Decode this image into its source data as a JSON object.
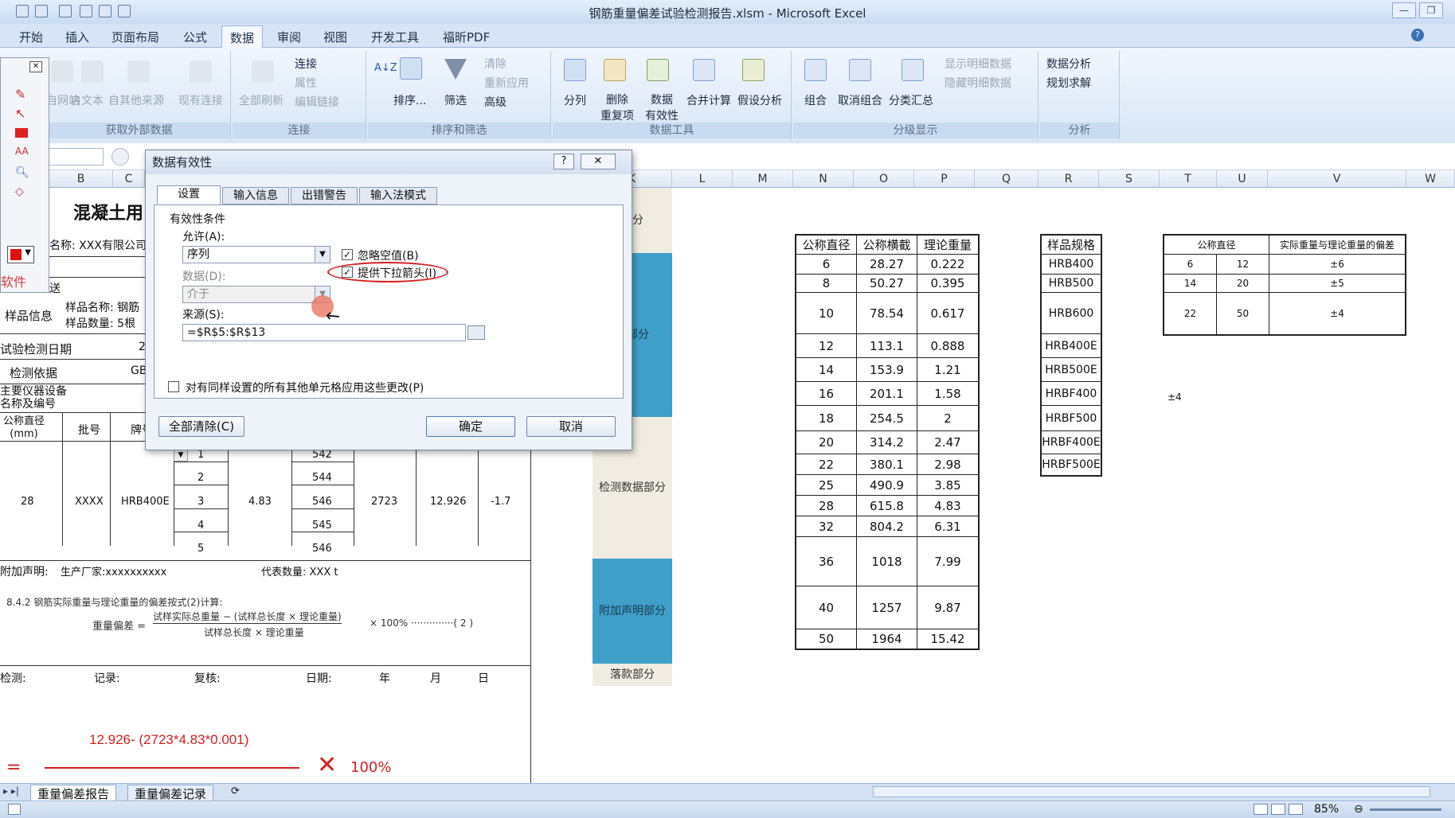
{
  "window": {
    "title": "钢筋重量偏差试验检测报告.xlsm - Microsoft Excel"
  },
  "tabs": [
    "开始",
    "插入",
    "页面布局",
    "公式",
    "数据",
    "审阅",
    "视图",
    "开发工具",
    "福昕PDF"
  ],
  "active_tab": "数据",
  "ribbon": {
    "ext": {
      "items": [
        "自网站",
        "自文本",
        "自其他来源",
        "现有连接"
      ],
      "label": "获取外部数据"
    },
    "conn": {
      "refresh": "全部刷新",
      "items": [
        "连接",
        "属性",
        "编辑链接"
      ],
      "label": "连接"
    },
    "sort": {
      "sort": "排序...",
      "filter": "筛选",
      "items": [
        "清除",
        "重新应用",
        "高级"
      ],
      "label": "排序和筛选"
    },
    "tools": {
      "items": [
        "分列",
        "删除\n重复项",
        "数据\n有效性",
        "合并计算",
        "假设分析"
      ],
      "label": "数据工具"
    },
    "outline": {
      "items": [
        "组合",
        "取消组合",
        "分类汇总"
      ],
      "small": [
        "显示明细数据",
        "隐藏明细数据"
      ],
      "label": "分级显示"
    },
    "analysis": {
      "items": [
        "数据分析",
        "规划求解"
      ],
      "label": "分析"
    }
  },
  "columns": [
    "B",
    "C",
    "K",
    "L",
    "M",
    "N",
    "O",
    "P",
    "Q",
    "R",
    "S",
    "T",
    "U",
    "V",
    "W"
  ],
  "report": {
    "title": "混凝土用",
    "company": "名称: XXX有限公司",
    "sent": "送",
    "sample_info": "样品信息",
    "sample_name": "样品名称: 钢筋",
    "sample_count": "样品数量: 5根",
    "test_date": "试验检测日期",
    "test_date_val": "2",
    "basis": "检测依据",
    "basis_val": "GB",
    "equipment": "主要仪器设备\n名称及编号",
    "h_dia": "公称直径\n(mm)",
    "h_batch": "批号",
    "h_brand": "牌号",
    "row": {
      "dia": "28",
      "batch": "XXXX",
      "brand": "HRB400E",
      "idx": [
        "1",
        "2",
        "3",
        "4",
        "5"
      ],
      "w": "4.83",
      "lens": [
        "542",
        "544",
        "546",
        "545",
        "546"
      ],
      "total": "2723",
      "mass": "12.926",
      "dev": "-1.7"
    },
    "note": "附加声明:",
    "maker": "生产厂家:xxxxxxxxxx",
    "rep": "代表数量: XXX t",
    "formula_title": "8.4.2  钢筋实际重量与理论重量的偏差按式(2)计算:",
    "formula_lhs": "重量偏差 =",
    "formula_num": "试样实际总重量 − (试样总长度 × 理论重量)",
    "formula_den": "试样总长度 × 理论重量",
    "formula_tail": "× 100%  ··············( 2 )",
    "sign": [
      "检测:",
      "记录:",
      "复核:",
      "日期:",
      "年",
      "月",
      "日"
    ]
  },
  "parts": [
    "部分",
    "息部分",
    "检测数据部分",
    "附加声明部分",
    "落款部分"
  ],
  "table_n": {
    "headers": [
      "公称直径",
      "公称横截",
      "理论重量"
    ],
    "rows": [
      [
        "6",
        "28.27",
        "0.222"
      ],
      [
        "8",
        "50.27",
        "0.395"
      ],
      [
        "10",
        "78.54",
        "0.617"
      ],
      [
        "12",
        "113.1",
        "0.888"
      ],
      [
        "14",
        "153.9",
        "1.21"
      ],
      [
        "16",
        "201.1",
        "1.58"
      ],
      [
        "18",
        "254.5",
        "2"
      ],
      [
        "20",
        "314.2",
        "2.47"
      ],
      [
        "22",
        "380.1",
        "2.98"
      ],
      [
        "25",
        "490.9",
        "3.85"
      ],
      [
        "28",
        "615.8",
        "4.83"
      ],
      [
        "32",
        "804.2",
        "6.31"
      ],
      [
        "36",
        "1018",
        "7.99"
      ],
      [
        "40",
        "1257",
        "9.87"
      ],
      [
        "50",
        "1964",
        "15.42"
      ]
    ]
  },
  "table_r": {
    "header": "样品规格",
    "rows": [
      "HRB400",
      "HRB500",
      "HRB600",
      "HRB400E",
      "HRB500E",
      "HRBF400",
      "HRBF500",
      "HRBF400E",
      "HRBF500E"
    ]
  },
  "table_t": {
    "headers": [
      "公称直径",
      "实际重量与理论重量的偏差"
    ],
    "rows": [
      [
        "6",
        "12",
        "±6"
      ],
      [
        "14",
        "20",
        "±5"
      ],
      [
        "22",
        "50",
        "±4"
      ]
    ]
  },
  "t_extra": "±4",
  "handwriting": {
    "expr": "12.926- (2723*4.83*0.001)",
    "eq": "=",
    "pct": "100%"
  },
  "sheets": [
    "重量偏差报告",
    "重量偏差记录"
  ],
  "zoom": "85%",
  "left_panel": {
    "label": "软件"
  },
  "dialog": {
    "title": "数据有效性",
    "help": "?",
    "close": "✕",
    "tabs": [
      "设置",
      "输入信息",
      "出错警告",
      "输入法模式"
    ],
    "group": "有效性条件",
    "allow_label": "允许(A):",
    "allow_value": "序列",
    "ignore_blank": "忽略空值(B)",
    "dropdown": "提供下拉箭头(I)",
    "data_label": "数据(D):",
    "data_value": "介于",
    "source_label": "来源(S):",
    "source_value": "=$R$5:$R$13",
    "apply_all": "对有同样设置的所有其他单元格应用这些更改(P)",
    "clear": "全部清除(C)",
    "ok": "确定",
    "cancel": "取消"
  }
}
